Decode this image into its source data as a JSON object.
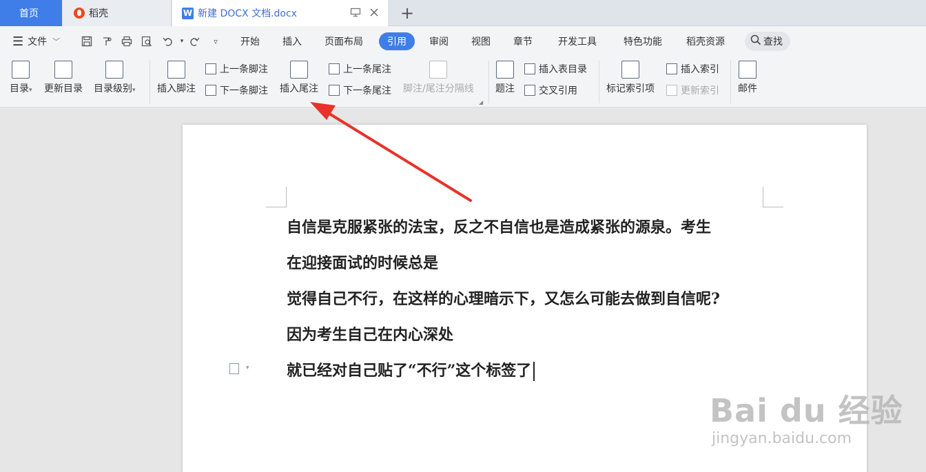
{
  "tabs": {
    "home": "首页",
    "daoke": "稻壳",
    "doc": "新建 DOCX 文档.docx",
    "plus": "+"
  },
  "menu": {
    "file": "文件",
    "items": [
      "开始",
      "插入",
      "页面布局",
      "引用",
      "审阅",
      "视图",
      "章节",
      "开发工具",
      "特色功能",
      "稻壳资源"
    ],
    "active": "引用",
    "search": "查找"
  },
  "ribbon": {
    "toc": "目录",
    "update_toc": "更新目录",
    "toc_level": "目录级别",
    "insert_footnote": "插入脚注",
    "prev_footnote": "上一条脚注",
    "next_footnote": "下一条脚注",
    "insert_endnote": "插入尾注",
    "prev_endnote": "上一条尾注",
    "next_endnote": "下一条尾注",
    "separator": "脚注/尾注分隔线",
    "caption": "题注",
    "insert_table_toc": "插入表目录",
    "cross_ref": "交叉引用",
    "mark_index": "标记索引项",
    "insert_index": "插入索引",
    "update_index": "更新索引",
    "mail": "邮件"
  },
  "document": {
    "lines": [
      "自信是克服紧张的法宝，反之不自信也是造成紧张的源泉。考生",
      "在迎接面试的时候总是",
      "觉得自己不行，在这样的心理暗示下，又怎么可能去做到自信呢?",
      "因为考生自己在内心深处",
      "就已经对自己贴了“不行”这个标签了"
    ]
  },
  "watermark": {
    "main": "Bai du 经验",
    "sub": "jingyan.baidu.com"
  },
  "colors": {
    "accent": "#3f7ee8",
    "arrow": "#e8322a"
  }
}
